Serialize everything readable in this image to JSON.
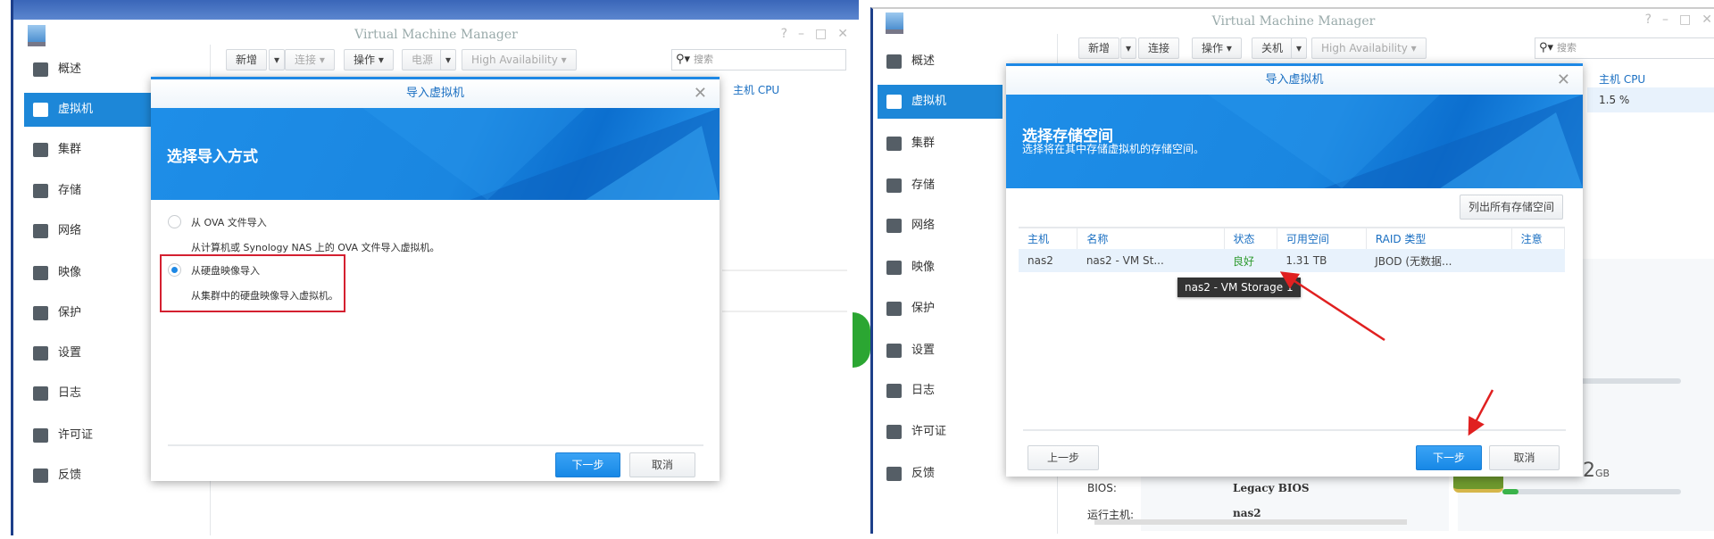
{
  "app_title": "Virtual Machine Manager",
  "sidebar": [
    "概述",
    "虚拟机",
    "集群",
    "存储",
    "网络",
    "映像",
    "保护",
    "设置",
    "日志",
    "许可证",
    "反馈"
  ],
  "sidebar_icons": [
    "overview-icon",
    "vm-icon",
    "cluster-icon",
    "storage-icon",
    "network-icon",
    "image-icon",
    "protection-icon",
    "gear-icon",
    "log-icon",
    "key-icon",
    "mail-icon"
  ],
  "selected_sidebar": "虚拟机",
  "left": {
    "toolbar": {
      "create": "新增",
      "connect": "连接 ▾",
      "action": "操作 ▾",
      "power": "电源",
      "ha": "High Availability ▾",
      "search_placeholder": "搜索"
    },
    "column": "主机 CPU",
    "dialog": {
      "title": "导入虚拟机",
      "banner": "选择导入方式",
      "options": [
        {
          "label": "从 OVA 文件导入",
          "desc": "从计算机或 Synology NAS 上的 OVA 文件导入虚拟机。",
          "selected": false
        },
        {
          "label": "从硬盘映像导入",
          "desc": "从集群中的硬盘映像导入虚拟机。",
          "selected": true
        }
      ],
      "next": "下一步",
      "cancel": "取消"
    }
  },
  "right": {
    "toolbar": {
      "create": "新增",
      "connect": "连接",
      "action": "操作 ▾",
      "power": "关机",
      "ha": "High Availability ▾",
      "search_placeholder": "搜索"
    },
    "column": "主机 CPU",
    "cpu_value": "1.5 %",
    "info": {
      "bios_label": "BIOS:",
      "bios_value": "Legacy BIOS",
      "host_label": "运行主机:",
      "host_value": "nas2",
      "memory": "2",
      "memory_unit": "GB"
    },
    "dialog": {
      "title": "导入虚拟机",
      "banner": "选择存储空间",
      "banner_sub": "选择将在其中存储虚拟机的存储空间。",
      "list_all": "列出所有存储空间",
      "columns": [
        "主机",
        "名称",
        "状态",
        "可用空间",
        "RAID 类型",
        "注意"
      ],
      "rows": [
        [
          "nas2",
          "nas2 - VM St...",
          "良好",
          "1.31 TB",
          "JBOD (无数据...",
          ""
        ]
      ],
      "tooltip": "nas2 - VM Storage 1",
      "prev": "上一步",
      "next": "下一步",
      "cancel": "取消"
    },
    "status_color": "#2e9a2e"
  },
  "accent": "#1e88e5",
  "annotation_color": "#e02020"
}
